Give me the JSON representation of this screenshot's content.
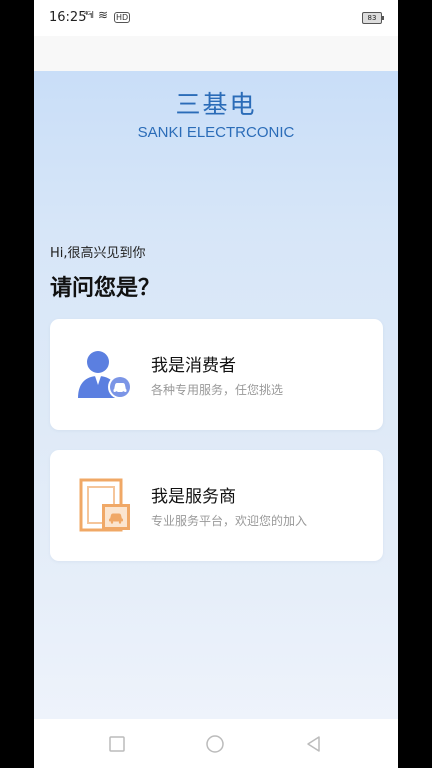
{
  "status_bar": {
    "time": "16:25",
    "signal": "⁴ᴳıl",
    "wifi": "≋",
    "hd": "HD",
    "battery": "83"
  },
  "brand": {
    "title": "三基电",
    "subtitle": "SANKI ELECTRCONIC"
  },
  "greeting": "Hi,很高兴见到你",
  "question": "请问您是？",
  "roles": [
    {
      "title": "我是消费者",
      "subtitle": "各种专用服务，任您挑选",
      "icon": "consumer-user-icon"
    },
    {
      "title": "我是服务商",
      "subtitle": "专业服务平台，欢迎您的加入",
      "icon": "provider-frame-icon"
    }
  ],
  "colors": {
    "brand_blue": "#2b6cb8",
    "consumer_icon_blue": "#5b7fe0",
    "provider_icon_orange": "#f0a866"
  },
  "nav": {
    "recent": "recent-apps-icon",
    "home": "home-icon",
    "back": "back-icon"
  }
}
